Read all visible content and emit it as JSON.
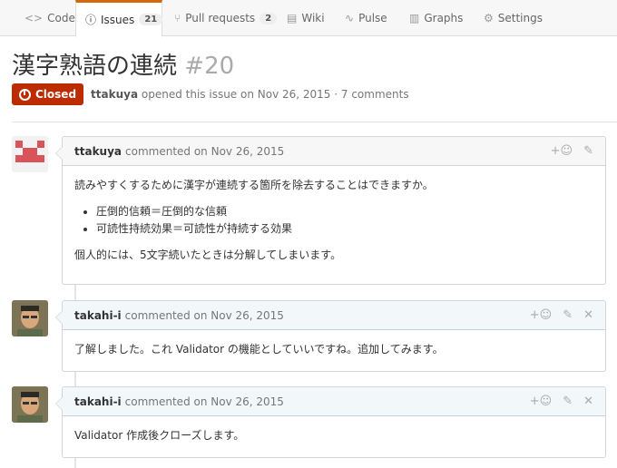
{
  "tabs": [
    {
      "label": "Code",
      "icon": "code-icon"
    },
    {
      "label": "Issues",
      "icon": "issue-opened-icon",
      "count": "21",
      "selected": true
    },
    {
      "label": "Pull requests",
      "icon": "pull-request-icon",
      "count": "2"
    },
    {
      "label": "Wiki",
      "icon": "book-icon"
    },
    {
      "label": "Pulse",
      "icon": "pulse-icon"
    },
    {
      "label": "Graphs",
      "icon": "graph-icon"
    },
    {
      "label": "Settings",
      "icon": "gear-icon"
    }
  ],
  "issue": {
    "title": "漢字熟語の連続",
    "number": "#20",
    "state": "Closed",
    "author": "ttakuya",
    "opened_text": "opened this issue on Nov 26, 2015 · 7 comments"
  },
  "comments": [
    {
      "author": "ttakuya",
      "meta": "commented on Nov 26, 2015",
      "para1": "読みやすくするために漢字が連続する箇所を除去することはできますか。",
      "bullets": [
        "圧倒的信頼＝圧倒的な信頼",
        "可読性持続効果＝可読性が持続する効果"
      ],
      "para2": "個人的には、5文字続いたときは分解してしまいます。"
    },
    {
      "author": "takahi-i",
      "meta": "commented on Nov 26, 2015",
      "para1": "了解しました。これ Validator の機能としていいですね。追加してみます。"
    },
    {
      "author": "takahi-i",
      "meta": "commented on Nov 26, 2015",
      "para1": "Validator 作成後クローズします。"
    }
  ],
  "colors": {
    "accent": "#d26911",
    "closed": "#bd2c00"
  }
}
